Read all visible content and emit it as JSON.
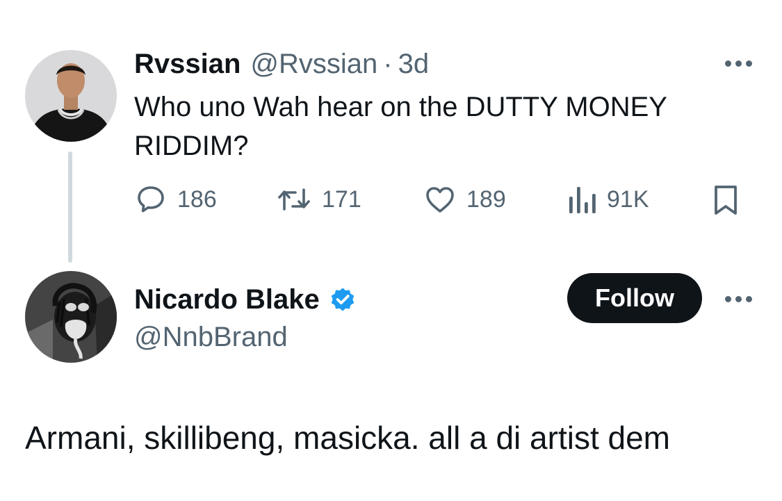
{
  "tweet": {
    "author_name": "Rvssian",
    "author_handle": "@Rvssian",
    "separator": "·",
    "time": "3d",
    "text": "Who uno Wah hear on the DUTTY MONEY RIDDIM?",
    "stats": {
      "replies": "186",
      "reposts": "171",
      "likes": "189",
      "views": "91K"
    }
  },
  "reply": {
    "author_name": "Nicardo Blake",
    "author_handle": "@NnbBrand",
    "follow_label": "Follow",
    "text": "Armani, skillibeng, masicka. all a di artist dem"
  },
  "colors": {
    "text_primary": "#0f1419",
    "text_secondary": "#536471",
    "verified_blue": "#1d9bf0",
    "follow_bg": "#0f1419",
    "thread_line": "#cfd9de"
  }
}
